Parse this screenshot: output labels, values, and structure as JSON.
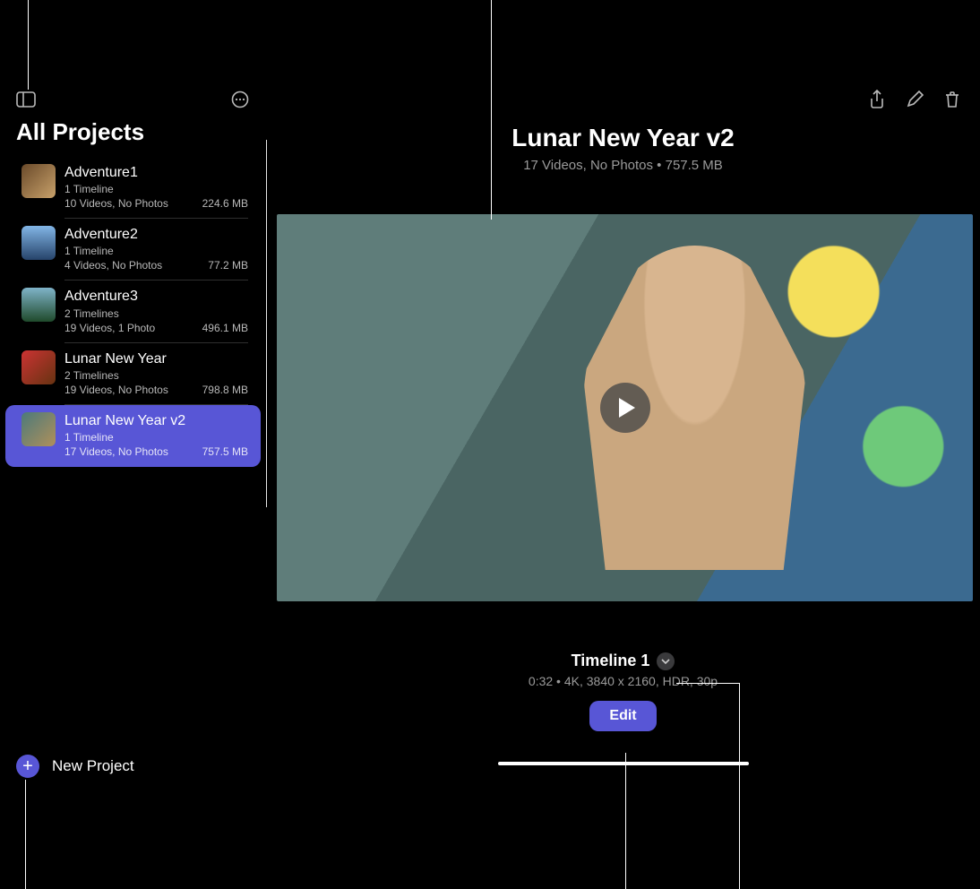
{
  "sidebar": {
    "title": "All Projects",
    "projects": [
      {
        "name": "Adventure1",
        "timelines": "1 Timeline",
        "media": "10 Videos, No Photos",
        "size": "224.6 MB",
        "thumb": "linear-gradient(135deg,#6a4a2a,#c8a16a)"
      },
      {
        "name": "Adventure2",
        "timelines": "1 Timeline",
        "media": "4 Videos, No Photos",
        "size": "77.2 MB",
        "thumb": "linear-gradient(180deg,#82b5e6,#26436a)"
      },
      {
        "name": "Adventure3",
        "timelines": "2 Timelines",
        "media": "19 Videos, 1 Photo",
        "size": "496.1 MB",
        "thumb": "linear-gradient(180deg,#7fb3c9,#1f4a2b)"
      },
      {
        "name": "Lunar New Year",
        "timelines": "2 Timelines",
        "media": "19 Videos, No Photos",
        "size": "798.8 MB",
        "thumb": "linear-gradient(135deg,#c33,#631)"
      },
      {
        "name": "Lunar New Year v2",
        "timelines": "1 Timeline",
        "media": "17 Videos, No Photos",
        "size": "757.5 MB",
        "thumb": "linear-gradient(135deg,#4c7a7a,#b0905a)"
      }
    ],
    "selected_index": 4,
    "new_project_label": "New Project"
  },
  "main": {
    "title": "Lunar New Year v2",
    "subtitle": "17 Videos, No Photos • 757.5 MB",
    "timeline": {
      "name": "Timeline 1",
      "meta": "0:32 • 4K, 3840 x 2160, HDR, 30p",
      "edit_label": "Edit"
    }
  }
}
